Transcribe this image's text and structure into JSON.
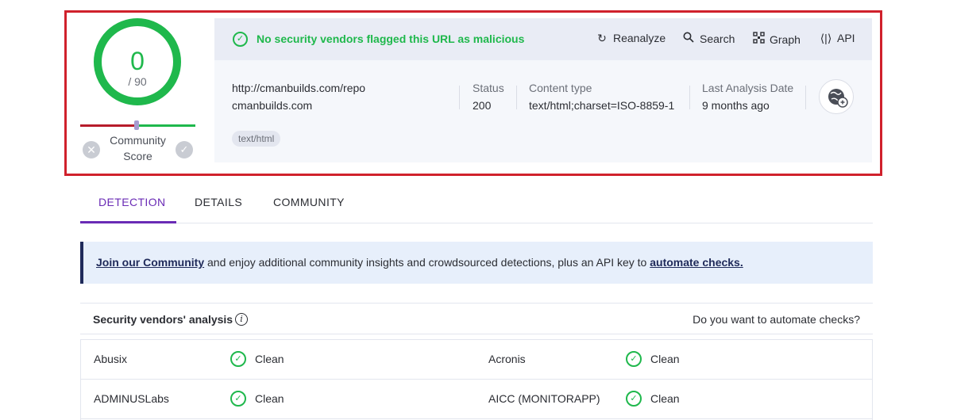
{
  "summary": {
    "score": "0",
    "total": "/ 90",
    "community_label_line1": "Community",
    "community_label_line2": "Score",
    "community_score_fraction": 0.5
  },
  "banner": {
    "message": "No security vendors flagged this URL as malicious",
    "actions": [
      {
        "label": "Reanalyze",
        "icon": "refresh-icon"
      },
      {
        "label": "Search",
        "icon": "search-icon"
      },
      {
        "label": "Graph",
        "icon": "graph-icon"
      },
      {
        "label": "API",
        "icon": "api-icon"
      }
    ]
  },
  "url_info": {
    "url": "http://cmanbuilds.com/repo",
    "domain": "cmanbuilds.com",
    "tag": "text/html",
    "status_label": "Status",
    "status_value": "200",
    "content_type_label": "Content type",
    "content_type_value": "text/html;charset=ISO-8859-1",
    "last_analysis_label": "Last Analysis Date",
    "last_analysis_value": "9 months ago"
  },
  "tabs": [
    {
      "label": "DETECTION",
      "active": true
    },
    {
      "label": "DETAILS",
      "active": false
    },
    {
      "label": "COMMUNITY",
      "active": false
    }
  ],
  "notice": {
    "join_link": "Join our Community",
    "middle_text": " and enjoy additional community insights and crowdsourced detections, plus an API key to ",
    "automate_link": "automate checks."
  },
  "vendors": {
    "title": "Security vendors' analysis",
    "automate_question": "Do you want to automate checks?",
    "rows": [
      [
        {
          "name": "Abusix",
          "status": "Clean"
        },
        {
          "name": "Acronis",
          "status": "Clean"
        }
      ],
      [
        {
          "name": "ADMINUSLabs",
          "status": "Clean"
        },
        {
          "name": "AICC (MONITORAPP)",
          "status": "Clean"
        }
      ]
    ]
  },
  "colors": {
    "clean_green": "#1fb84c",
    "accent_purple": "#6a2bb5",
    "highlight_red": "#d0212c",
    "malicious_red": "#b71c2b"
  }
}
